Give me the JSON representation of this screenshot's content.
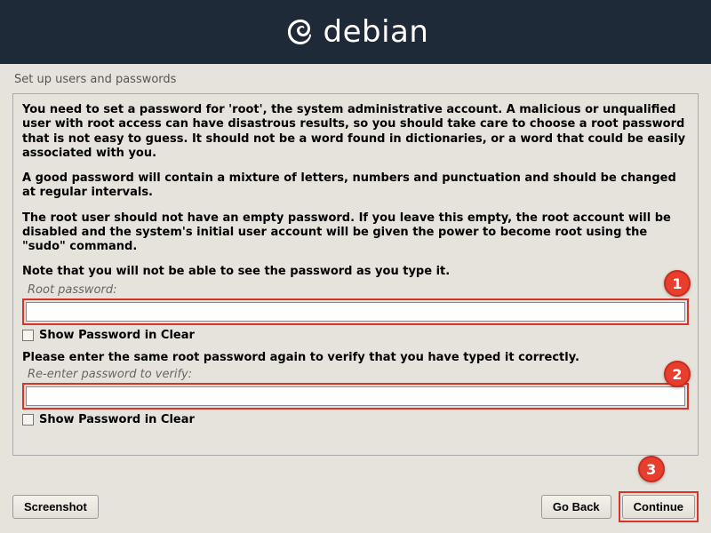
{
  "header": {
    "brand": "debian"
  },
  "page_title": "Set up users and passwords",
  "paragraphs": {
    "p1": "You need to set a password for 'root', the system administrative account. A malicious or unqualified user with root access can have disastrous results, so you should take care to choose a root password that is not easy to guess. It should not be a word found in dictionaries, or a word that could be easily associated with you.",
    "p2": "A good password will contain a mixture of letters, numbers and punctuation and should be changed at regular intervals.",
    "p3": "The root user should not have an empty password. If you leave this empty, the root account will be disabled and the system's initial user account will be given the power to become root using the \"sudo\" command.",
    "p4": "Note that you will not be able to see the password as you type it."
  },
  "fields": {
    "root_password_label": "Root password:",
    "root_password_value": "",
    "show_password_1": "Show Password in Clear",
    "verify_text": "Please enter the same root password again to verify that you have typed it correctly.",
    "reenter_label": "Re-enter password to verify:",
    "reenter_value": "",
    "show_password_2": "Show Password in Clear"
  },
  "buttons": {
    "screenshot": "Screenshot",
    "go_back": "Go Back",
    "continue": "Continue"
  },
  "annotations": {
    "badge1": "1",
    "badge2": "2",
    "badge3": "3"
  }
}
